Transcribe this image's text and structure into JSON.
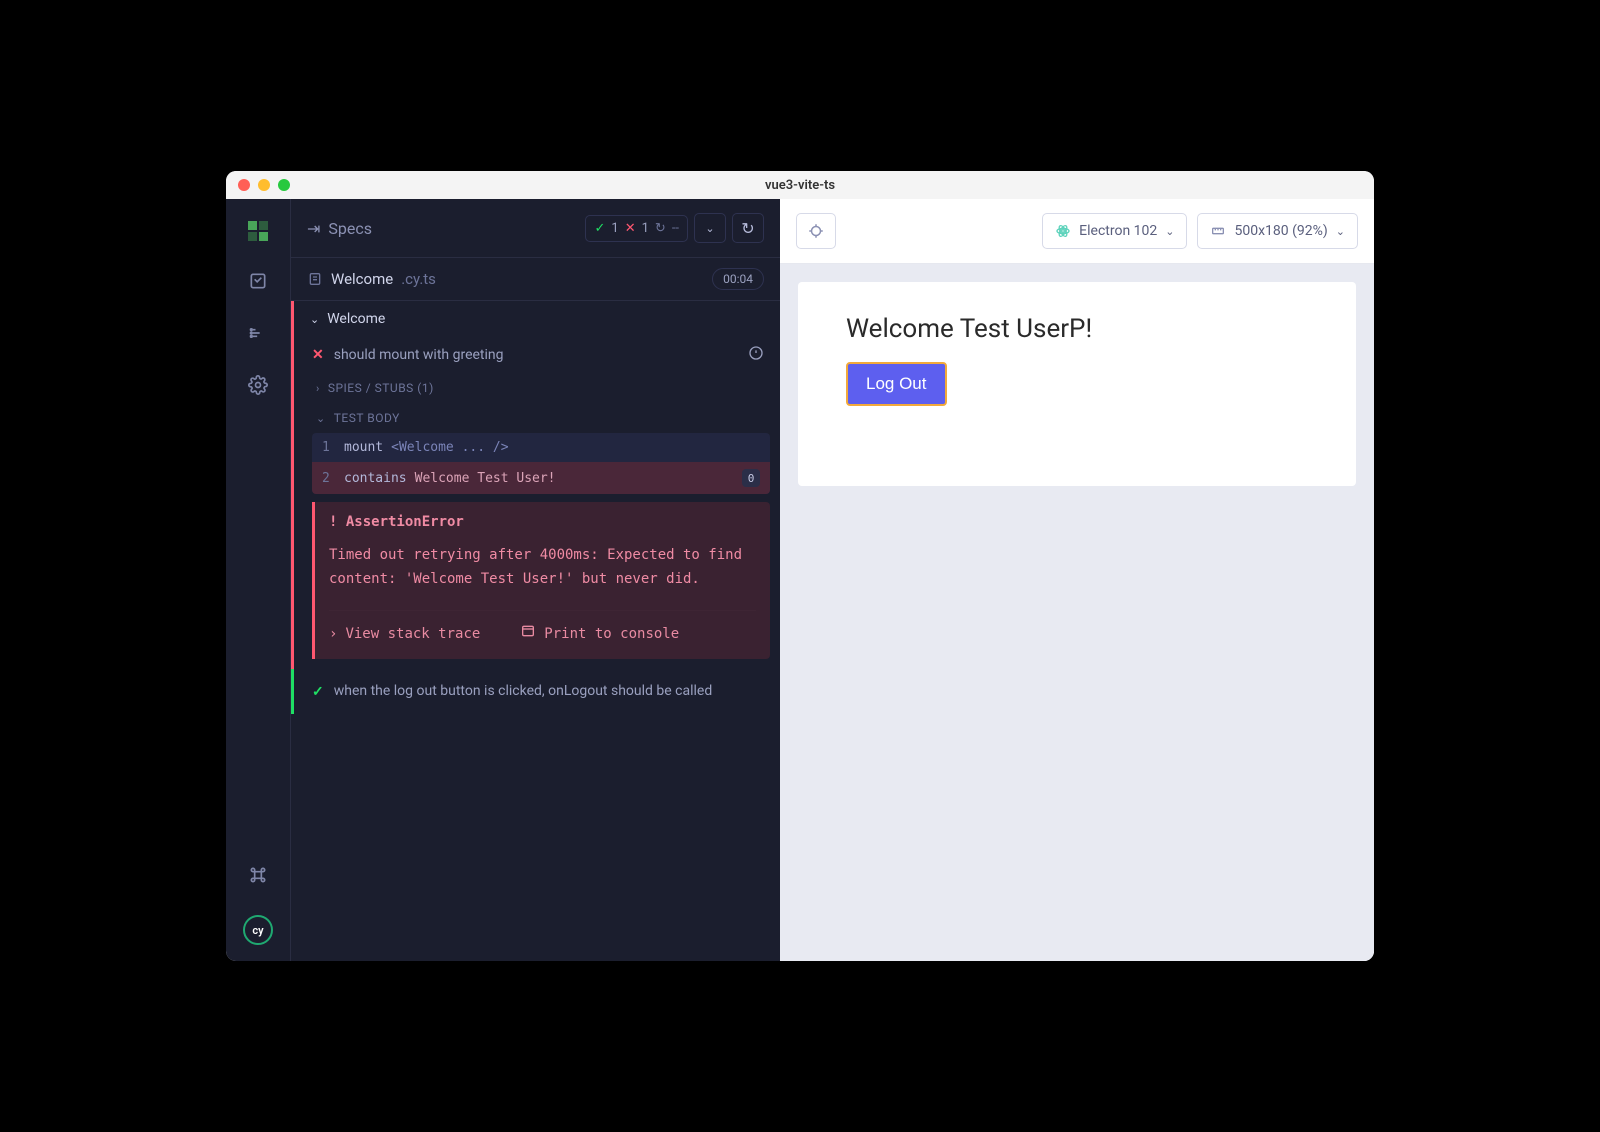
{
  "window": {
    "title": "vue3-vite-ts"
  },
  "reporter": {
    "specs_label": "Specs",
    "status": {
      "pass": "1",
      "fail": "1",
      "retry": "--"
    },
    "spec_file": {
      "name": "Welcome",
      "ext": ".cy.ts",
      "duration": "00:04"
    },
    "suite": {
      "name": "Welcome",
      "failing_test": "should mount with greeting",
      "spies_label": "SPIES / STUBS (1)",
      "body_label": "TEST BODY",
      "lines": [
        {
          "n": "1",
          "cmd": "mount",
          "arg": "<Welcome ... />",
          "err": false,
          "badge": ""
        },
        {
          "n": "2",
          "cmd": "contains",
          "arg": "Welcome Test User!",
          "err": true,
          "badge": "0"
        }
      ],
      "error": {
        "title": "! AssertionError",
        "message": "Timed out retrying after 4000ms: Expected to find content: 'Welcome Test User!' but never did.",
        "actions": {
          "stack": "View stack trace",
          "print": "Print to console"
        }
      },
      "passing_test": "when the log out button is clicked, onLogout should be called"
    }
  },
  "preview": {
    "browser_label": "Electron 102",
    "viewport_label": "500x180 (92%)",
    "welcome_heading": "Welcome Test UserP!",
    "logout_label": "Log Out"
  }
}
